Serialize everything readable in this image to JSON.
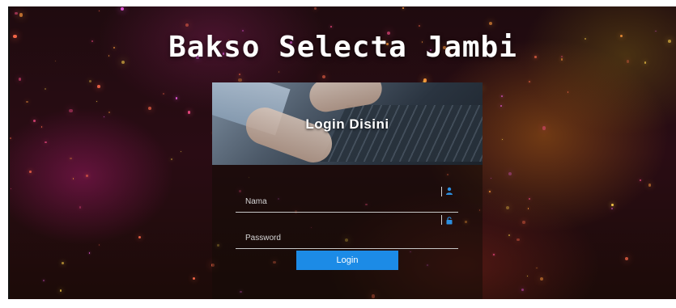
{
  "page": {
    "title": "Bakso Selecta Jambi"
  },
  "login_card": {
    "banner_title": "Login Disini",
    "username": {
      "placeholder": "Nama",
      "value": "",
      "icon": "user-icon"
    },
    "password": {
      "placeholder": "Password",
      "value": "",
      "icon": "lock-icon"
    },
    "submit_label": "Login"
  },
  "colors": {
    "accent": "#1c8be6",
    "icon": "#2b8fe0",
    "text": "#ffffff"
  }
}
